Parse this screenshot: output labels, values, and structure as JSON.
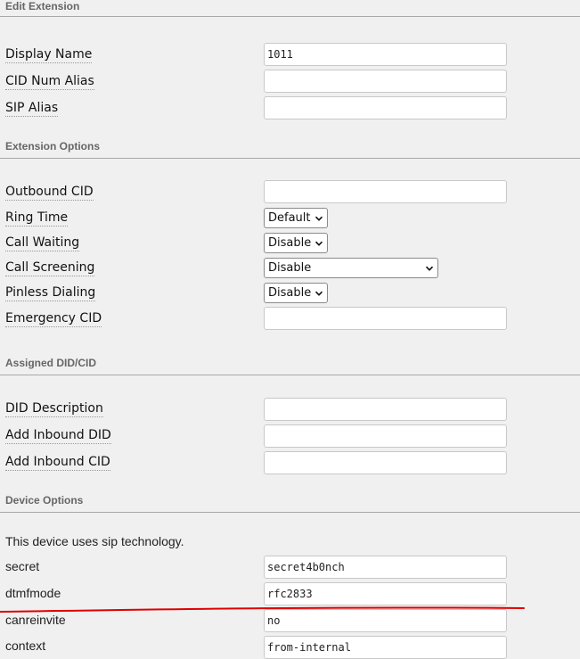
{
  "sections": {
    "edit_extension": "Edit Extension",
    "extension_options": "Extension Options",
    "assigned_did": "Assigned DID/CID",
    "device_options": "Device Options"
  },
  "fields": {
    "display_name": {
      "label": "Display Name",
      "value": "1011"
    },
    "cid_num_alias": {
      "label": "CID Num Alias",
      "value": ""
    },
    "sip_alias": {
      "label": "SIP Alias",
      "value": ""
    },
    "outbound_cid": {
      "label": "Outbound CID",
      "value": ""
    },
    "ring_time": {
      "label": "Ring Time",
      "selected": "Default"
    },
    "call_waiting": {
      "label": "Call Waiting",
      "selected": "Disable"
    },
    "call_screening": {
      "label": "Call Screening",
      "selected": "Disable"
    },
    "pinless_dialing": {
      "label": "Pinless Dialing",
      "selected": "Disable"
    },
    "emergency_cid": {
      "label": "Emergency CID",
      "value": ""
    },
    "did_description": {
      "label": "DID Description",
      "value": ""
    },
    "add_inbound_did": {
      "label": "Add Inbound DID",
      "value": ""
    },
    "add_inbound_cid": {
      "label": "Add Inbound CID",
      "value": ""
    }
  },
  "device": {
    "note": "This device uses sip technology.",
    "secret": {
      "label": "secret",
      "value": "secret4b0nch"
    },
    "dtmfmode": {
      "label": "dtmfmode",
      "value": "rfc2833"
    },
    "canreinvite": {
      "label": "canreinvite",
      "value": "no"
    },
    "context": {
      "label": "context",
      "value": "from-internal"
    }
  },
  "colors": {
    "background": "#f0f0f0",
    "section_text": "#666666",
    "annotation": "#e00000"
  },
  "icons": {
    "select_arrow": "chevron-down-icon"
  }
}
